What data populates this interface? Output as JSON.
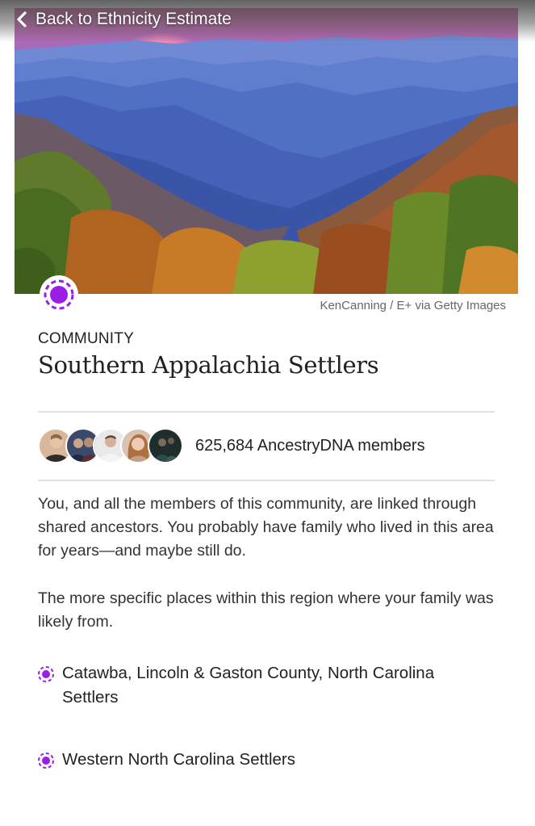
{
  "nav": {
    "back_label": "Back to Ethnicity Estimate"
  },
  "hero": {
    "credit": "KenCanning / E+ via Getty Images"
  },
  "community": {
    "kicker": "COMMUNITY",
    "title": "Southern Appalachia Settlers",
    "members_text": "625,684 AncestryDNA members",
    "description": "You, and all the members of this community, are linked through shared ancestors. You probably have family who lived in this area for years—and maybe still do.",
    "regions_intro": "The more specific places within this region where your family was likely from.",
    "regions": [
      {
        "label": "Catawba, Lincoln & Gaston County, North Carolina Settlers"
      },
      {
        "label": "Western North Carolina Settlers"
      }
    ]
  },
  "colors": {
    "accent": "#9b1de6",
    "text": "#222222",
    "divider": "#e3e3e3"
  },
  "icons": {
    "back": "chevron-left-icon",
    "community": "community-dot-icon",
    "region": "region-dot-icon"
  }
}
